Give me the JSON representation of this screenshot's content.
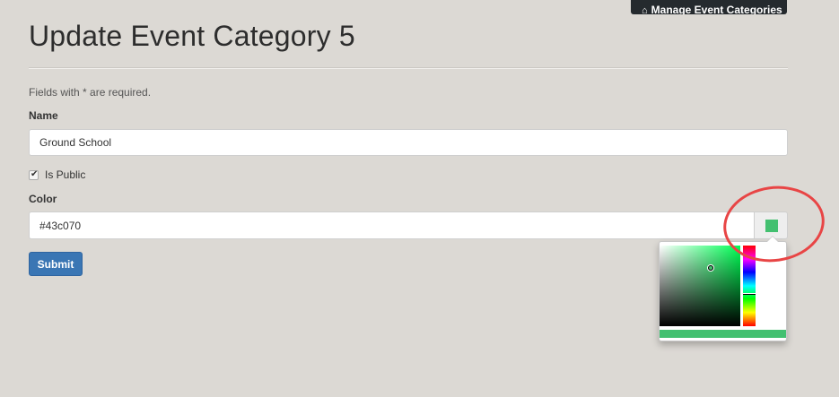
{
  "header": {
    "manage_button_label": "Manage Event Categories"
  },
  "page": {
    "title": "Update Event Category 5",
    "required_hint": "Fields with * are required."
  },
  "form": {
    "name_label": "Name",
    "name_value": "Ground School",
    "is_public_label": "Is Public",
    "is_public_checked": true,
    "color_label": "Color",
    "color_value": "#43c070",
    "submit_label": "Submit"
  },
  "colors": {
    "selected": "#43c070",
    "primary_button": "#3a76b4",
    "top_button": "#252a2e",
    "annotation": "#e84545"
  }
}
